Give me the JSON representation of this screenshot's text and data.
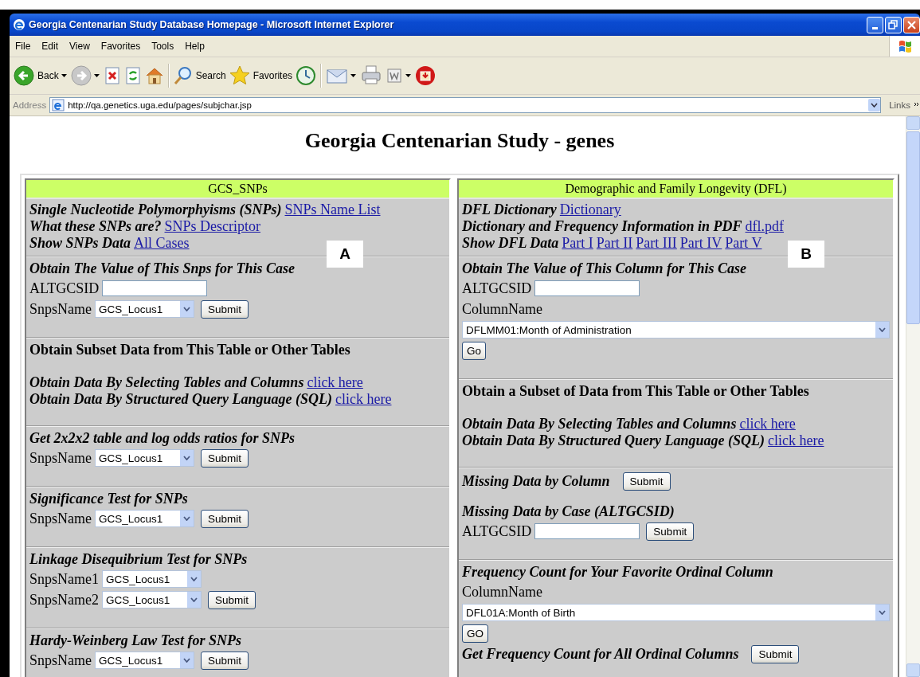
{
  "window": {
    "title": "Georgia Centenarian Study Database Homepage - Microsoft Internet Explorer"
  },
  "menu": [
    "File",
    "Edit",
    "View",
    "Favorites",
    "Tools",
    "Help"
  ],
  "toolbar": [
    {
      "kind": "back",
      "label": "Back",
      "menu": true
    },
    {
      "kind": "forward",
      "menu": true
    },
    {
      "kind": "stop"
    },
    {
      "kind": "refresh"
    },
    {
      "kind": "home"
    },
    {
      "kind": "search",
      "label": "Search"
    },
    {
      "kind": "favorites",
      "label": "Favorites"
    },
    {
      "kind": "history"
    },
    {
      "kind": "mail",
      "menu": true
    },
    {
      "kind": "print"
    },
    {
      "kind": "edit",
      "menu": true
    },
    {
      "kind": "messenger"
    }
  ],
  "address": {
    "label": "Address",
    "value": "http://qa.genetics.uga.edu/pages/subjchar.jsp",
    "links": "Links"
  },
  "page": {
    "title": "Georgia Centenarian Study - genes",
    "panels": [
      {
        "header": "GCS_SNPs",
        "marker": "A",
        "sections": [
          {
            "kind": "info",
            "items": [
              {
                "kind": "info",
                "text": "Single Nucleotide Polymorphyisms (SNPs)",
                "links": [
                  "SNPs Name List"
                ]
              },
              {
                "kind": "info",
                "text": "What these SNPs are?",
                "links": [
                  "SNPs Descriptor"
                ]
              },
              {
                "kind": "info",
                "text": "Show SNPs Data",
                "links": [
                  "All Cases"
                ]
              }
            ]
          },
          {
            "kind": "form",
            "items": [
              {
                "kind": "heading",
                "text": "Obtain The Value of This Snps for This Case"
              },
              {
                "kind": "row",
                "parts": [
                  {
                    "kind": "label",
                    "text": "ALTGCSID"
                  },
                  {
                    "kind": "input"
                  }
                ]
              },
              {
                "kind": "row",
                "parts": [
                  {
                    "kind": "label",
                    "text": "SnpsName"
                  },
                  {
                    "kind": "select",
                    "value": "GCS_Locus1"
                  },
                  {
                    "kind": "button",
                    "label": "Submit"
                  }
                ]
              }
            ]
          },
          {
            "kind": "form",
            "items": [
              {
                "kind": "title",
                "text": "Obtain Subset Data from This Table or Other Tables"
              },
              {
                "kind": "info",
                "text": "Obtain Data By Selecting Tables and Columns",
                "links": [
                  "click here"
                ]
              },
              {
                "kind": "info",
                "text": "Obtain Data By Structured Query Language (SQL)",
                "links": [
                  "click here"
                ]
              }
            ]
          },
          {
            "kind": "form",
            "items": [
              {
                "kind": "heading",
                "text": "Get 2x2x2 table and log odds ratios for SNPs"
              },
              {
                "kind": "row",
                "parts": [
                  {
                    "kind": "label",
                    "text": "SnpsName"
                  },
                  {
                    "kind": "select",
                    "value": "GCS_Locus1"
                  },
                  {
                    "kind": "button",
                    "label": "Submit"
                  }
                ]
              }
            ]
          },
          {
            "kind": "form",
            "items": [
              {
                "kind": "heading",
                "text": "Significance Test for SNPs"
              },
              {
                "kind": "row",
                "parts": [
                  {
                    "kind": "label",
                    "text": "SnpsName"
                  },
                  {
                    "kind": "select",
                    "value": "GCS_Locus1"
                  },
                  {
                    "kind": "button",
                    "label": "Submit"
                  }
                ]
              }
            ]
          },
          {
            "kind": "form",
            "items": [
              {
                "kind": "heading",
                "text": "Linkage Disequibrium Test for SNPs"
              },
              {
                "kind": "row",
                "parts": [
                  {
                    "kind": "label",
                    "text": "SnpsName1"
                  },
                  {
                    "kind": "select",
                    "value": "GCS_Locus1"
                  }
                ]
              },
              {
                "kind": "row",
                "parts": [
                  {
                    "kind": "label",
                    "text": "SnpsName2"
                  },
                  {
                    "kind": "select",
                    "value": "GCS_Locus1"
                  },
                  {
                    "kind": "button",
                    "label": "Submit"
                  }
                ]
              }
            ]
          },
          {
            "kind": "form",
            "items": [
              {
                "kind": "heading",
                "text": "Hardy-Weinberg Law Test for SNPs"
              },
              {
                "kind": "row",
                "parts": [
                  {
                    "kind": "label",
                    "text": "SnpsName"
                  },
                  {
                    "kind": "select",
                    "value": "GCS_Locus1"
                  },
                  {
                    "kind": "button",
                    "label": "Submit"
                  }
                ]
              }
            ]
          }
        ]
      },
      {
        "header": "Demographic and Family Longevity (DFL)",
        "marker": "B",
        "sections": [
          {
            "kind": "info",
            "items": [
              {
                "kind": "info",
                "text": "DFL Dictionary",
                "links": [
                  "Dictionary"
                ]
              },
              {
                "kind": "info",
                "text": "Dictionary and Frequency Information in PDF",
                "links": [
                  "dfl.pdf"
                ]
              },
              {
                "kind": "info",
                "text": "Show DFL Data",
                "links": [
                  "Part I",
                  "Part II",
                  "Part III",
                  "Part IV",
                  "Part V"
                ]
              }
            ]
          },
          {
            "kind": "form",
            "items": [
              {
                "kind": "heading",
                "text": "Obtain The Value of This Column for This Case"
              },
              {
                "kind": "row",
                "parts": [
                  {
                    "kind": "label",
                    "text": "ALTGCSID"
                  },
                  {
                    "kind": "input"
                  }
                ]
              },
              {
                "kind": "row",
                "parts": [
                  {
                    "kind": "label",
                    "text": "ColumnName"
                  }
                ]
              },
              {
                "kind": "row",
                "parts": [
                  {
                    "kind": "wide_select",
                    "value": "DFLMM01:Month of Administration"
                  }
                ]
              },
              {
                "kind": "row",
                "parts": [
                  {
                    "kind": "button",
                    "label": "Go"
                  }
                ]
              }
            ]
          },
          {
            "kind": "form",
            "items": [
              {
                "kind": "title",
                "text": "Obtain a Subset of Data from This Table or Other Tables"
              },
              {
                "kind": "info",
                "text": "Obtain Data By Selecting Tables and Columns",
                "links": [
                  "click here"
                ]
              },
              {
                "kind": "info",
                "text": "Obtain Data By Structured Query Language (SQL)",
                "links": [
                  "click here"
                ]
              }
            ]
          },
          {
            "kind": "form",
            "items": [
              {
                "kind": "row",
                "parts": [
                  {
                    "kind": "heading",
                    "text": "Missing Data by Column"
                  },
                  {
                    "kind": "button",
                    "label": "Submit"
                  }
                ]
              },
              {
                "kind": "heading",
                "text": "Missing Data by Case (ALTGCSID)"
              },
              {
                "kind": "row",
                "parts": [
                  {
                    "kind": "label",
                    "text": "ALTGCSID"
                  },
                  {
                    "kind": "input"
                  },
                  {
                    "kind": "button",
                    "label": "Submit"
                  }
                ]
              }
            ]
          },
          {
            "kind": "form",
            "items": [
              {
                "kind": "heading",
                "text": "Frequency Count for Your Favorite Ordinal Column"
              },
              {
                "kind": "row",
                "parts": [
                  {
                    "kind": "label",
                    "text": "ColumnName"
                  }
                ]
              },
              {
                "kind": "row",
                "parts": [
                  {
                    "kind": "wide_select",
                    "value": "DFL01A:Month of Birth"
                  }
                ]
              },
              {
                "kind": "row",
                "parts": [
                  {
                    "kind": "button",
                    "label": "GO"
                  }
                ]
              },
              {
                "kind": "row",
                "parts": [
                  {
                    "kind": "heading",
                    "text": "Get Frequency Count for All Ordinal Columns"
                  },
                  {
                    "kind": "button",
                    "label": "Submit"
                  }
                ]
              }
            ]
          }
        ]
      }
    ]
  }
}
